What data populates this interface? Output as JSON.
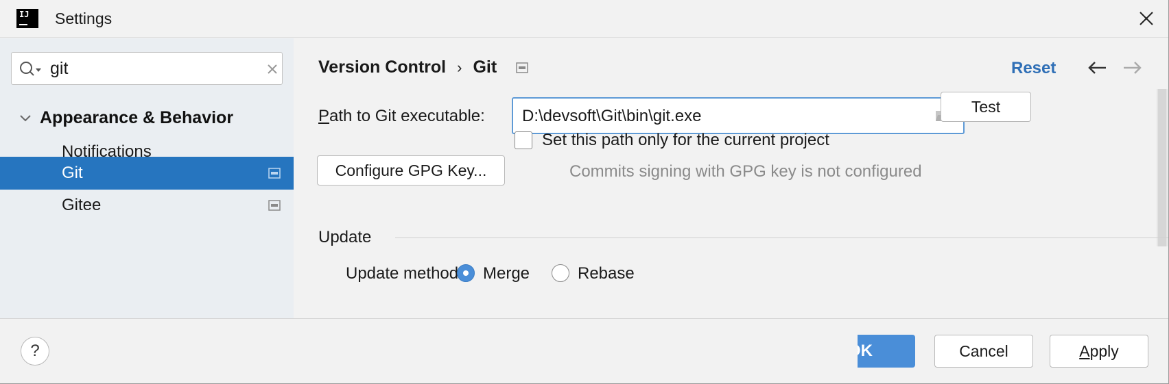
{
  "window": {
    "title": "Settings",
    "app_icon": "intellij-logo-icon",
    "app_logo_text": "IJ"
  },
  "search": {
    "value": "git"
  },
  "sidebar": {
    "group_label": "Appearance & Behavior",
    "items": [
      {
        "label": "Notifications",
        "selected": false,
        "project_icon": false
      },
      {
        "label": "Git",
        "selected": true,
        "project_icon": true
      },
      {
        "label": "Gitee",
        "selected": false,
        "project_icon": true
      }
    ]
  },
  "header": {
    "breadcrumb_parent": "Version Control",
    "breadcrumb_separator": "›",
    "breadcrumb_current": "Git",
    "reset_label": "Reset"
  },
  "git": {
    "path_label_mnemonic": "P",
    "path_label_rest": "ath to Git executable:",
    "path_value": "D:\\devsoft\\Git\\bin\\git.exe",
    "test_label": "Test",
    "project_only_label": "Set this path only for the current project",
    "project_only_checked": false,
    "gpg_button_label": "Configure GPG Key...",
    "gpg_status": "Commits signing with GPG key is not configured"
  },
  "update": {
    "section_title": "Update",
    "method_label": "Update method:",
    "options": [
      {
        "label": "Merge",
        "selected": true
      },
      {
        "label": "Rebase",
        "selected": false
      }
    ]
  },
  "footer": {
    "help_label": "?",
    "ok_label": "OK",
    "cancel_label": "Cancel",
    "apply_mnemonic": "A",
    "apply_rest": "pply"
  },
  "colors": {
    "selection": "#2675bf",
    "accent": "#4a8ed8",
    "link": "#2f6fb6",
    "sidebar_bg": "#eaeef2",
    "window_bg": "#f2f2f2"
  }
}
